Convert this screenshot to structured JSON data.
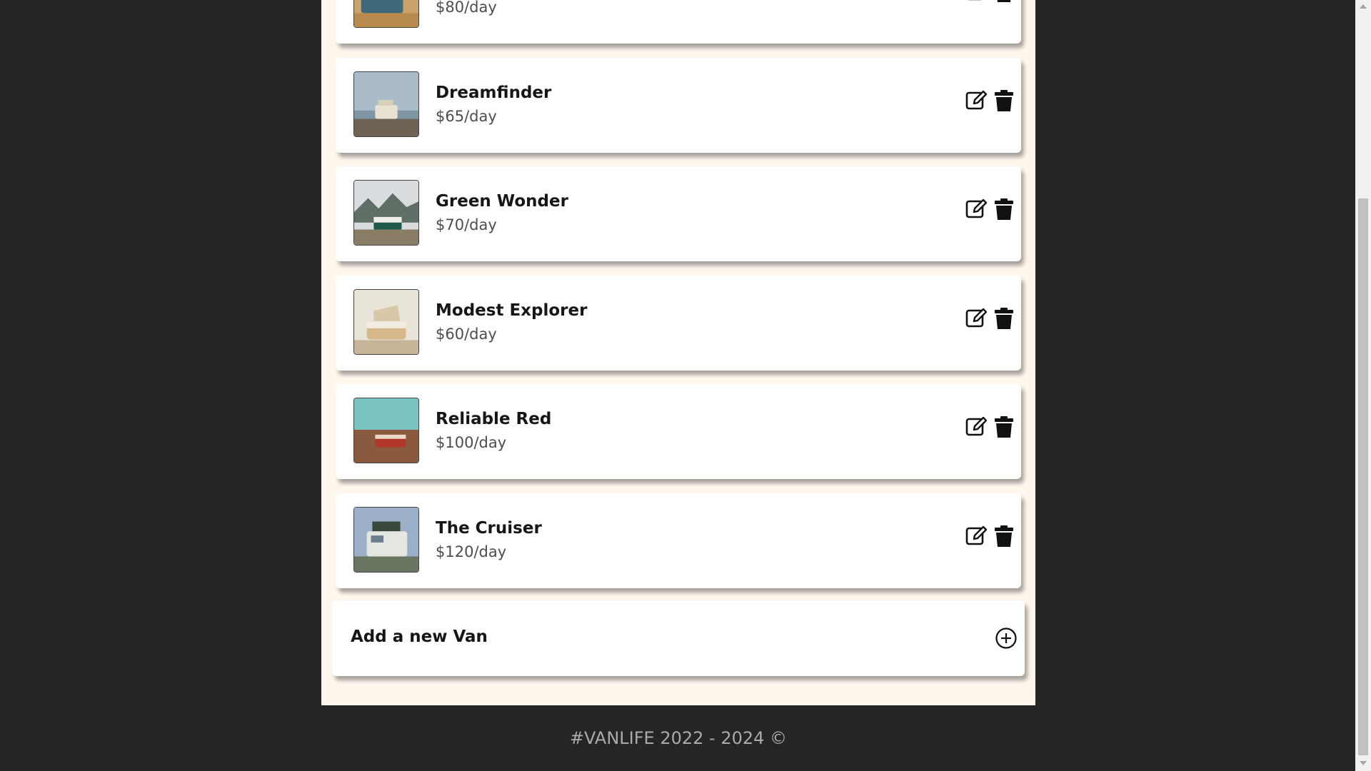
{
  "vans": [
    {
      "name": "",
      "price": "$80/day"
    },
    {
      "name": "Dreamfinder",
      "price": "$65/day"
    },
    {
      "name": "Green Wonder",
      "price": "$70/day"
    },
    {
      "name": "Modest Explorer",
      "price": "$60/day"
    },
    {
      "name": "Reliable Red",
      "price": "$100/day"
    },
    {
      "name": "The Cruiser",
      "price": "$120/day"
    }
  ],
  "add_van": {
    "label": "Add a new Van",
    "icon": "plus-circle-icon"
  },
  "footer": {
    "text": "#VANLIFE 2022 - 2024 ©"
  },
  "icons": {
    "edit": "edit-icon",
    "delete": "trash-icon"
  },
  "colors": {
    "page_bg": "#fff7ed",
    "frame_bg": "#252525",
    "card_bg": "#ffffff"
  }
}
